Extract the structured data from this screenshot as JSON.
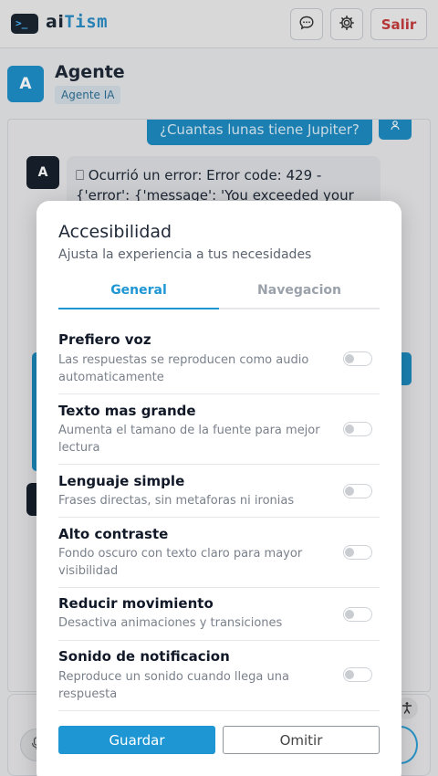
{
  "header": {
    "logo_prompt": ">_",
    "app_name_a": "ai",
    "app_name_b": "Tism",
    "chat_icon": "chat-bubble-icon",
    "settings_icon": "gear-icon",
    "exit_label": "Salir"
  },
  "agent": {
    "avatar_letter": "A",
    "name": "Agente",
    "badge": "Agente IA"
  },
  "chat": {
    "user_message": "¿Cuantas lunas tiene Jupiter?",
    "bot_avatar_letter": "A",
    "bot_message": "⎕ Ocurrió un error: Error code: 429 - {'error': {'message': 'You exceeded your current"
  },
  "modal": {
    "title": "Accesibilidad",
    "subtitle": "Ajusta la experiencia a tus necesidades",
    "tabs": [
      "General",
      "Navegacion"
    ],
    "active_tab": "General",
    "options": [
      {
        "title": "Prefiero voz",
        "desc": "Las respuestas se reproducen como audio automaticamente",
        "enabled": false
      },
      {
        "title": "Texto mas grande",
        "desc": "Aumenta el tamano de la fuente para mejor lectura",
        "enabled": false
      },
      {
        "title": "Lenguaje simple",
        "desc": "Frases directas, sin metaforas ni ironias",
        "enabled": false
      },
      {
        "title": "Alto contraste",
        "desc": "Fondo oscuro con texto claro para mayor visibilidad",
        "enabled": false
      },
      {
        "title": "Reducir movimiento",
        "desc": "Desactiva animaciones y transiciones",
        "enabled": false
      },
      {
        "title": "Sonido de notificacion",
        "desc": "Reproduce un sonido cuando llega una respuesta",
        "enabled": false
      }
    ],
    "save_label": "Guardar",
    "skip_label": "Omitir"
  },
  "colors": {
    "accent": "#1e96d3",
    "danger": "#c43b3b",
    "dark": "#16202c"
  }
}
